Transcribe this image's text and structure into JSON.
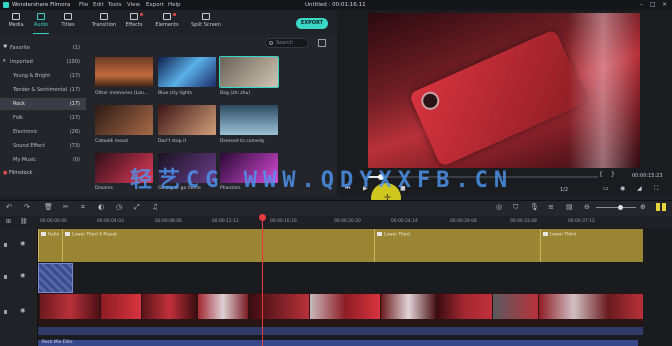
{
  "titlebar": {
    "app_name": "Wondershare Filmora",
    "menu": [
      "File",
      "Edit",
      "Tools",
      "View",
      "Export",
      "Help"
    ],
    "project": "Untitled : 00:01:16:11"
  },
  "toolbar": {
    "tabs": [
      "Media",
      "Audio",
      "Titles",
      "Transition",
      "Effects",
      "Elements",
      "Split Screen"
    ],
    "active_tab": "Audio",
    "export_label": "EXPORT"
  },
  "categories": [
    {
      "name": "Favorite",
      "count": "(1)"
    },
    {
      "name": "Imported",
      "count": "(100)"
    },
    {
      "name": "Young & Bright",
      "count": "(17)"
    },
    {
      "name": "Tender & Sentimental",
      "count": "(17)"
    },
    {
      "name": "Rock",
      "count": "(17)"
    },
    {
      "name": "Folk",
      "count": "(17)"
    },
    {
      "name": "Electronic",
      "count": "(26)"
    },
    {
      "name": "Sound Effect",
      "count": "(73)"
    },
    {
      "name": "My Music",
      "count": "(0)"
    }
  ],
  "selected_category": "Rock",
  "filemark_label": "Filmstock",
  "search": {
    "placeholder": "Search"
  },
  "thumbnails": [
    {
      "label": "Other memories (Lon...",
      "c1": "#3b2418",
      "c2": "#c26a3a"
    },
    {
      "label": "Blue city lights",
      "c1": "#0e1f4a",
      "c2": "#5ab0e8"
    },
    {
      "label": "Bag (zhi zhu)",
      "c1": "#6a6258",
      "c2": "#cfc6b4"
    },
    {
      "label": "Catwalk mood",
      "c1": "#2c1a14",
      "c2": "#a86a48"
    },
    {
      "label": "Don't stop it",
      "c1": "#3c1616",
      "c2": "#d2a07a"
    },
    {
      "label": "Dressed to comedy",
      "c1": "#2c4a62",
      "c2": "#9cc2d6"
    },
    {
      "label": "Dreams",
      "c1": "#301018",
      "c2": "#e03a5a"
    },
    {
      "label": "Go big or go home",
      "c1": "#1a1222",
      "c2": "#6a3e8a"
    },
    {
      "label": "Phantom",
      "c1": "#2a0a34",
      "c2": "#d64ad8"
    }
  ],
  "preview": {
    "timecode": "00:00:15:23",
    "quality": "1/2",
    "progress": 0.05
  },
  "watermark": "轻艺CG WWW.QDYXXFB.CN",
  "timeline": {
    "ticks": [
      "00:00:00:00",
      "00:00:04:03",
      "00:00:08:06",
      "00:00:12:12",
      "00:00:16:16",
      "00:00:20:20",
      "00:00:24:24",
      "00:00:29:04",
      "00:00:33:08",
      "00:00:37:12"
    ],
    "title_clips": [
      "Hello",
      "Lower Third 4 Preset",
      "Lower Third",
      "Lower Third"
    ],
    "bottom_label": "Rock Mix Elite"
  }
}
